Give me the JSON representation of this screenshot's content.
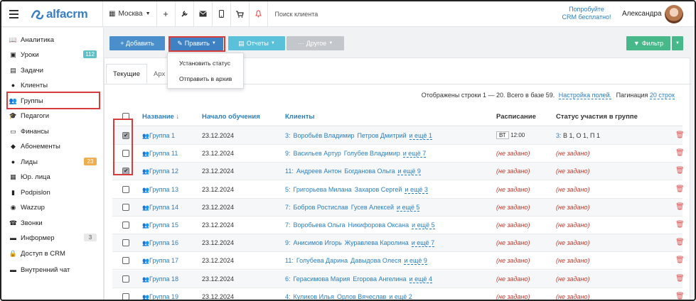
{
  "topbar": {
    "logo_text": "alfacrm",
    "city": "Москва",
    "search_placeholder": "Поиск клиента",
    "trial_line1": "Попробуйте",
    "trial_line2": "CRM бесплатно!",
    "user_name": "Александра"
  },
  "sidebar": {
    "items": [
      {
        "label": "Аналитика",
        "icon": "book-icon"
      },
      {
        "label": "Уроки",
        "icon": "calendar-icon",
        "badge": "112"
      },
      {
        "label": "Задачи",
        "icon": "clipboard-icon"
      },
      {
        "label": "Клиенты",
        "icon": "user-icon"
      },
      {
        "label": "Группы",
        "icon": "users-icon"
      },
      {
        "label": "Педагоги",
        "icon": "graduation-cap-icon"
      },
      {
        "label": "Финансы",
        "icon": "money-icon"
      },
      {
        "label": "Абонементы",
        "icon": "tag-icon"
      },
      {
        "label": "Лиды",
        "icon": "user-plus-icon",
        "badge": "23"
      },
      {
        "label": "Юр. лица",
        "icon": "building-icon"
      },
      {
        "label": "Podpislon",
        "icon": "file-icon"
      },
      {
        "label": "Wazzup",
        "icon": "whatsapp-icon"
      },
      {
        "label": "Звонки",
        "icon": "phone-icon"
      },
      {
        "label": "Информер",
        "icon": "info-icon",
        "badge": "3"
      },
      {
        "label": "Доступ в CRM",
        "icon": "lock-icon"
      },
      {
        "label": "Внутренний чат",
        "icon": "chat-icon"
      }
    ]
  },
  "toolbar": {
    "add": "+ Добавить",
    "edit": "Править",
    "reports": "Отчеты",
    "other": "Другое",
    "filter": "Фильтр"
  },
  "tabs": {
    "current": "Текущие",
    "archive": "Арх"
  },
  "dropdown": {
    "set_status": "Установить статус",
    "archive": "Отправить в архив"
  },
  "info": {
    "shown": "Отображены строки 1 — 20. Всего в базе 59.",
    "settings": "Настройка полей.",
    "pagination_label": "Пагинация",
    "pagination_value": "20 строк"
  },
  "table": {
    "headers": {
      "name": "Название ↓",
      "start": "Начало обучения",
      "clients": "Клиенты",
      "schedule": "Расписание",
      "status": "Статус участия в группе"
    },
    "rows": [
      {
        "checked": true,
        "name": "Группа 1",
        "date": "23.12.2024",
        "count": "3:",
        "c1": "Воробьёв Владимир",
        "c2": "Петров Дмитрий",
        "more": "и ещё 1",
        "day": "ВТ",
        "time": "12:00",
        "status_count": "3:",
        "status": "В 1, О 1, П 1"
      },
      {
        "checked": false,
        "name": "Группа 11",
        "date": "23.12.2024",
        "count": "9:",
        "c1": "Васильев Артур",
        "c2": "Голубев Владимир",
        "more": "и ещё 7",
        "schedule": "(не задано)",
        "status": "(не задано)"
      },
      {
        "checked": true,
        "name": "Группа 12",
        "date": "23.12.2024",
        "count": "11:",
        "c1": "Андреев Антон",
        "c2": "Богданова Ольга",
        "more": "и ещё 9",
        "schedule": "(не задано)",
        "status": "(не задано)"
      },
      {
        "checked": false,
        "name": "Группа 13",
        "date": "23.12.2024",
        "count": "5:",
        "c1": "Григорьева Милана",
        "c2": "Захаров Сергей",
        "more": "и ещё 3",
        "schedule": "(не задано)",
        "status": "(не задано)"
      },
      {
        "checked": false,
        "name": "Группа 14",
        "date": "23.12.2024",
        "count": "7:",
        "c1": "Бобров Ростислав",
        "c2": "Гусев Алексей",
        "more": "и ещё 5",
        "schedule": "(не задано)",
        "status": "(не задано)"
      },
      {
        "checked": false,
        "name": "Группа 15",
        "date": "23.12.2024",
        "count": "7:",
        "c1": "Воробьева Ольга",
        "c2": "Никифорова Оксана",
        "more": "и ещё 5",
        "schedule": "(не задано)",
        "status": "(не задано)"
      },
      {
        "checked": false,
        "name": "Группа 16",
        "date": "23.12.2024",
        "count": "9:",
        "c1": "Анисимов Игорь",
        "c2": "Журавлева Каролина",
        "more": "и ещё 7",
        "schedule": "(не задано)",
        "status": "(не задано)"
      },
      {
        "checked": false,
        "name": "Группа 17",
        "date": "23.12.2024",
        "count": "11:",
        "c1": "Голубева Дарина",
        "c2": "Давыдова Олеся",
        "more": "и ещё 9",
        "schedule": "(не задано)",
        "status": "(не задано)"
      },
      {
        "checked": false,
        "name": "Группа 18",
        "date": "23.12.2024",
        "count": "6:",
        "c1": "Герасимова Мария",
        "c2": "Егорова Ангелина",
        "more": "и ещё 4",
        "schedule": "(не задано)",
        "status": "(не задано)"
      },
      {
        "checked": false,
        "name": "Группа 19",
        "date": "23.12.2024",
        "count": "4:",
        "c1": "Куликов Илья",
        "c2": "Орлов Вячеслав",
        "more": "и ещё 2",
        "schedule": "(не задано)",
        "status": "(не задано)"
      }
    ]
  },
  "colors": {
    "accent": "#2a7fc0",
    "highlight": "#d63c3c",
    "notset": "#c0392b"
  }
}
